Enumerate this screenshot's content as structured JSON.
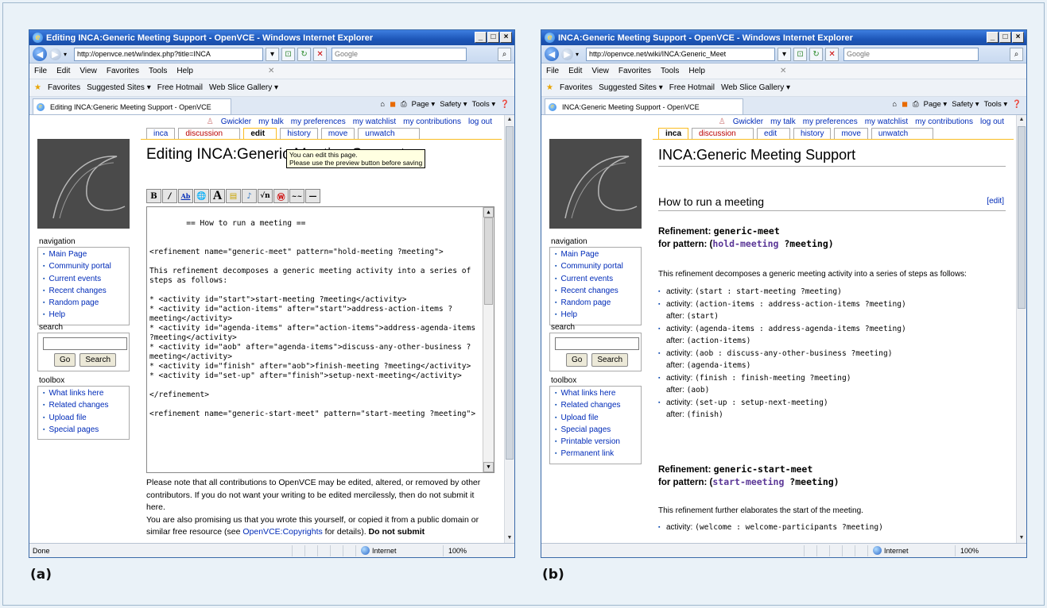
{
  "panels": [
    {
      "label": "(a)",
      "window_title": "Editing INCA:Generic Meeting Support - OpenVCE - Windows Internet Explorer",
      "url": "http://openvce.net/w/index.php?title=INCA",
      "search_placeholder": "Google",
      "menu": [
        "File",
        "Edit",
        "View",
        "Favorites",
        "Tools",
        "Help"
      ],
      "favorites": [
        "Favorites",
        "Suggested Sites ▾",
        "Free Hotmail",
        "Web Slice Gallery ▾"
      ],
      "tab_title": "Editing INCA:Generic Meeting Support - OpenVCE",
      "tab_tools": [
        "Page ▾",
        "Safety ▾",
        "Tools ▾"
      ],
      "status": "Done",
      "zone": "Internet",
      "zoom": "100%"
    },
    {
      "label": "(b)",
      "window_title": "INCA:Generic Meeting Support - OpenVCE - Windows Internet Explorer",
      "url": "http://openvce.net/wiki/INCA:Generic_Meet",
      "search_placeholder": "Google",
      "menu": [
        "File",
        "Edit",
        "View",
        "Favorites",
        "Tools",
        "Help"
      ],
      "favorites": [
        "Favorites",
        "Suggested Sites ▾",
        "Free Hotmail",
        "Web Slice Gallery ▾"
      ],
      "tab_title": "INCA:Generic Meeting Support - OpenVCE",
      "tab_tools": [
        "Page ▾",
        "Safety ▾",
        "Tools ▾"
      ],
      "status": "",
      "zone": "Internet",
      "zoom": "100%"
    }
  ],
  "wiki": {
    "userbar": [
      "Gwickler",
      "my talk",
      "my preferences",
      "my watchlist",
      "my contributions",
      "log out"
    ],
    "tabs": [
      "inca",
      "discussion",
      "edit",
      "history",
      "move",
      "unwatch"
    ],
    "navigation": {
      "heading": "navigation",
      "items": [
        "Main Page",
        "Community portal",
        "Current events",
        "Recent changes",
        "Random page",
        "Help"
      ]
    },
    "search": {
      "heading": "search",
      "go": "Go",
      "search": "Search"
    },
    "toolbox_a": {
      "heading": "toolbox",
      "items": [
        "What links here",
        "Related changes",
        "Upload file",
        "Special pages"
      ]
    },
    "toolbox_b": {
      "heading": "toolbox",
      "items": [
        "What links here",
        "Related changes",
        "Upload file",
        "Special pages",
        "Printable version",
        "Permanent link"
      ]
    }
  },
  "edit_page": {
    "title": "Editing INCA:Generic Meeting Support",
    "tooltip_line1": "You can edit this page.",
    "tooltip_line2": "Please use the preview button before saving",
    "source": "== How to run a meeting ==\n\n\n<refinement name=\"generic-meet\" pattern=\"hold-meeting ?meeting\">\n\nThis refinement decomposes a generic meeting activity into a series of steps as follows:\n\n* <activity id=\"start\">start-meeting ?meeting</activity>\n* <activity id=\"action-items\" after=\"start\">address-action-items ?meeting</activity>\n* <activity id=\"agenda-items\" after=\"action-items\">address-agenda-items ?meeting</activity>\n* <activity id=\"aob\" after=\"agenda-items\">discuss-any-other-business ?meeting</activity>\n* <activity id=\"finish\" after=\"aob\">finish-meeting ?meeting</activity>\n* <activity id=\"set-up\" after=\"finish\">setup-next-meeting</activity>\n\n</refinement>\n\n<refinement name=\"generic-start-meet\" pattern=\"start-meeting ?meeting\">",
    "note1": "Please note that all contributions to OpenVCE may be edited, altered, or removed by other contributors. If you do not want your writing to be edited mercilessly, then do not submit it here.",
    "note2_pre": "You are also promising us that you wrote this yourself, or copied it from a public domain or similar free resource (see ",
    "note2_link": "OpenVCE:Copyrights",
    "note2_post": " for details). ",
    "note2_bold": "Do not submit"
  },
  "view_page": {
    "title": "INCA:Generic Meeting Support",
    "section": "How to run a meeting",
    "edit_link": "[edit]",
    "ref1": {
      "label": "Refinement: ",
      "name": "generic-meet",
      "pattern_label": "for pattern: (",
      "pattern": "hold-meeting",
      "pattern_rest": " ?meeting)"
    },
    "ref1_intro": "This refinement decomposes a generic meeting activity into a series of steps as follows:",
    "activities": [
      {
        "text": "(start : start-meeting ?meeting)",
        "after": ""
      },
      {
        "text": "(action-items : address-action-items ?meeting)",
        "after": "(start)"
      },
      {
        "text": "(agenda-items : address-agenda-items ?meeting)",
        "after": "(action-items)"
      },
      {
        "text": "(aob : discuss-any-other-business ?meeting)",
        "after": "(agenda-items)"
      },
      {
        "text": "(finish : finish-meeting ?meeting)",
        "after": "(aob)"
      },
      {
        "text": "(set-up : setup-next-meeting)",
        "after": "(finish)"
      }
    ],
    "activity_label": "activity: ",
    "after_label": "after: ",
    "ref2": {
      "label": "Refinement: ",
      "name": "generic-start-meet",
      "pattern_label": "for pattern: (",
      "pattern": "start-meeting",
      "pattern_rest": " ?meeting)"
    },
    "ref2_intro": "This refinement further elaborates the start of the meeting.",
    "ref2_activity": "(welcome : welcome-participants ?meeting)"
  }
}
